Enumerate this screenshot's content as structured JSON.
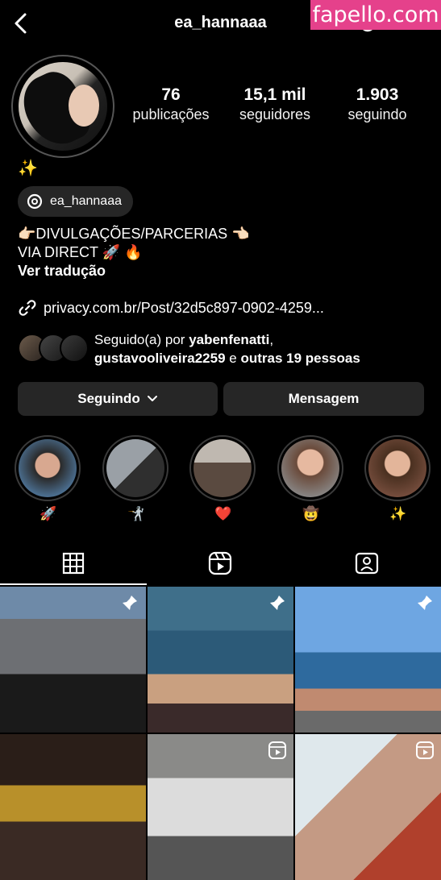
{
  "header": {
    "username": "ea_hannaaa",
    "watermark": "fapello.com"
  },
  "stats": [
    {
      "value": "76",
      "label": "publicações"
    },
    {
      "value": "15,1 mil",
      "label": "seguidores"
    },
    {
      "value": "1.903",
      "label": "seguindo"
    }
  ],
  "bio": {
    "name_emoji": "✨",
    "threads_handle": "ea_hannaaa",
    "line1": "👉🏻DIVULGAÇÕES/PARCERIAS 👈🏻",
    "line2": "VIA DIRECT 🚀 🔥",
    "translate": "Ver tradução",
    "link": "privacy.com.br/Post/32d5c897-0902-4259..."
  },
  "followed_by": {
    "prefix": "Seguido(a) por ",
    "user1": "yabenfenatti",
    "sep": ",",
    "user2": "gustavooliveira2259",
    "middle": " e ",
    "others": "outras 19 pessoas"
  },
  "buttons": {
    "following": "Seguindo",
    "message": "Mensagem"
  },
  "highlights": [
    {
      "label": "🚀"
    },
    {
      "label": "🤺"
    },
    {
      "label": "❤️"
    },
    {
      "label": "🤠"
    },
    {
      "label": "✨"
    }
  ],
  "tabs": [
    "grid",
    "reels",
    "tagged"
  ],
  "posts": [
    {
      "kind": "pinned"
    },
    {
      "kind": "pinned"
    },
    {
      "kind": "pinned"
    },
    {
      "kind": "post"
    },
    {
      "kind": "reel"
    },
    {
      "kind": "reel"
    }
  ],
  "colors": {
    "background": "#000000",
    "button": "#262626",
    "watermark": "#e5418b"
  }
}
